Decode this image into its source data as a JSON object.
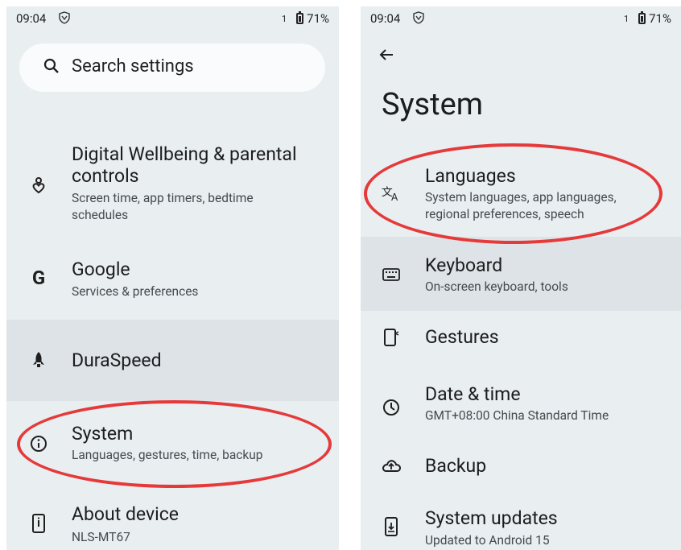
{
  "left": {
    "status": {
      "time": "09:04",
      "sim": "1",
      "battery": "71%"
    },
    "search": {
      "placeholder": "Search settings"
    },
    "items": [
      {
        "title": "Digital Wellbeing & parental controls",
        "title_line1": "Digital Wellbeing & parental",
        "title_line2": "controls",
        "subtitle_line1": "Screen time, app timers, bedtime",
        "subtitle_line2": "schedules",
        "icon": "wellbeing-icon"
      },
      {
        "title": "Google",
        "subtitle": "Services & preferences",
        "icon": "google-icon"
      },
      {
        "title": "DuraSpeed",
        "icon": "rocket-icon"
      },
      {
        "title": "System",
        "subtitle": "Languages, gestures, time, backup",
        "icon": "info-icon"
      },
      {
        "title": "About device",
        "subtitle": "NLS-MT67",
        "icon": "phone-icon"
      }
    ]
  },
  "right": {
    "status": {
      "time": "09:04",
      "sim": "1",
      "battery": "71%"
    },
    "page_title": "System",
    "items": [
      {
        "title": "Languages",
        "subtitle_line1": "System languages, app languages,",
        "subtitle_line2": "regional preferences, speech",
        "icon": "translate-icon"
      },
      {
        "title": "Keyboard",
        "subtitle": "On-screen keyboard, tools",
        "icon": "keyboard-icon"
      },
      {
        "title": "Gestures",
        "icon": "gestures-icon"
      },
      {
        "title": "Date & time",
        "subtitle": "GMT+08:00 China Standard Time",
        "icon": "clock-icon"
      },
      {
        "title": "Backup",
        "icon": "cloud-upload-icon"
      },
      {
        "title": "System updates",
        "subtitle": "Updated to Android 15",
        "icon": "system-update-icon"
      }
    ]
  },
  "colors": {
    "screen_bg": "#e9eef1",
    "highlight": "#dde3e6",
    "annotation": "#e5393a"
  }
}
